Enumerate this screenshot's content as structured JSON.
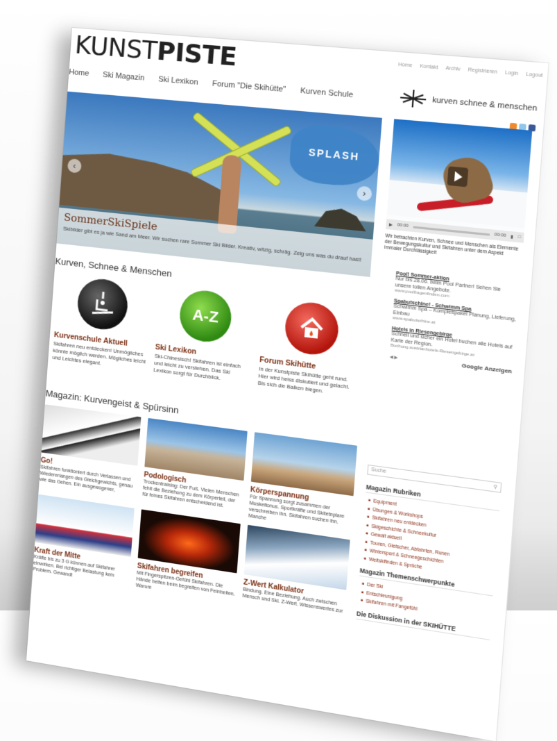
{
  "site": {
    "logo_light": "KUNST",
    "logo_bold": "PISTE",
    "tagline": "kurven schnee & menschen",
    "top_links": [
      "Home",
      "Kontakt",
      "Archiv",
      "Registrieren",
      "Login",
      "Logout"
    ]
  },
  "nav": [
    "Home",
    "Ski Magazin",
    "Ski Lexikon",
    "Forum \"Die Skihütte\"",
    "Kurven Schule"
  ],
  "slider": {
    "badge": "SPLASH",
    "title": "SommerSkiSpiele",
    "text": "Skibilder gibt es ja wie Sand am Meer. Wir suchen rare Sommer Ski Bilder. Kreativ, witzig, schräg. Zeig uns was du drauf hast!"
  },
  "video": {
    "time_start": "00:00",
    "time_end": "00:00",
    "description": "Wir betrachten Kurven, Schnee und Menschen als Elemente der Bewegungskultur und Skifahren unter dem Aspekt immaler Durchlässigkeit"
  },
  "ads": [
    {
      "title": "Pool! Sommer-aktion",
      "body": "Nur bis 28.06. beim Pool Partner! Sehen Sie unsere tollen Angebote.",
      "url": "www.poolfragenfinden.com"
    },
    {
      "title": "Spabutschine! - Schwimm Spa",
      "body": "Schwimm Spa – Komplettpaket Planung, Lieferung, Einbau",
      "url": "www.spabutschine.at"
    },
    {
      "title": "Hotels in Riesengebirge",
      "body": "Schnell und sicher ein Hotel buchen alle Hotels auf Karte der Region.",
      "url": "Buchung.austrianhotels-Riesengebirge.at"
    }
  ],
  "ads_footer": "Google Anzeigen",
  "section1": {
    "title": "Kurven, Schnee & Menschen",
    "cards": [
      {
        "icon": "ski-lift-icon",
        "title": "Kurvenschule Aktuell",
        "text": "Skifahren neu entdecken! Unmögliches könnte möglich werden. Mögliches leicht und Leichtes elegant."
      },
      {
        "icon_text": "A-Z",
        "title": "Ski Lexikon",
        "text": "Ski-Chinesisch! Skifahren ist einfach und leicht zu verstehen. Das Ski Lexikon sorgt für Durchblick."
      },
      {
        "icon": "house-icon",
        "title": "Forum Skihütte",
        "text": "In der Kunstpiste Skihütte geht rund. Hier wird heiss diskutiert und gelacht. Bis sich die Balken biegen."
      }
    ]
  },
  "section2": {
    "title": "Magazin: Kurvengeist & Spürsinn",
    "articles": [
      {
        "title": "Go!",
        "text": "Skifahren funktioniert durch Verlassen und Wiedererlangen des Gleichgewichts, genau wie das Gehen. Ein ausgewogener,"
      },
      {
        "title": "Podologisch",
        "text": "Trockentraining: Der Fuß. Vielen Menschen fehlt die Beziehung zu dem Körperteil, der für feines Skifahren entscheidend ist."
      },
      {
        "title": "Körperspannung",
        "text": "Für Spannung sorgt zusammen der Muskeltonus. Sportkräfte und Skitetnplare verschreiben ihn. Skifahren suchen ihn. Manche"
      },
      {
        "title": "Kraft der Mitte",
        "text": "Kräfte bis zu 3 G können auf Skifahrer einwirken. Bei richtiger Belastung kein Problem. Gewandt"
      },
      {
        "title": "Skifahren begreifen",
        "text": "Mit Fingerspitzen-Gefühl Skifahren. Die Hände helfen beim begreifen von Feinheiten. Warum"
      },
      {
        "title": "Z-Wert Kalkulator",
        "text": "Bindung. Eine Beziehung. Auch zwischen Mensch und Ski. Z-Wert. Wissenswertes zur"
      }
    ]
  },
  "sidebar": {
    "search_placeholder": "Suche",
    "rubriken_title": "Magazin Rubriken",
    "rubriken": [
      "Equipment",
      "Übungen & Workshops",
      "Skifahren neu entdecken",
      "Skigeschichte & Schneekultur",
      "Gewalt aktuell",
      "Touren, Gletscher, Abfahrten, Runen",
      "Wintersport & Schneegeschichten",
      "Weltskifinden & Sprüche"
    ],
    "themen_title": "Magazin Themenschwerpunkte",
    "themen": [
      "Der Ski",
      "Entschleunigung",
      "Skifahren mit Fangefühl"
    ],
    "diskussion_title": "Die Diskussion in der SKIHÜTTE"
  },
  "colors": {
    "accent_title": "#7a2e12",
    "link": "#8a2b14",
    "slider_sky": "#3b78be",
    "splash": "#3f84c7",
    "az_green": "#4aa51f",
    "forum_red": "#d8271c"
  }
}
